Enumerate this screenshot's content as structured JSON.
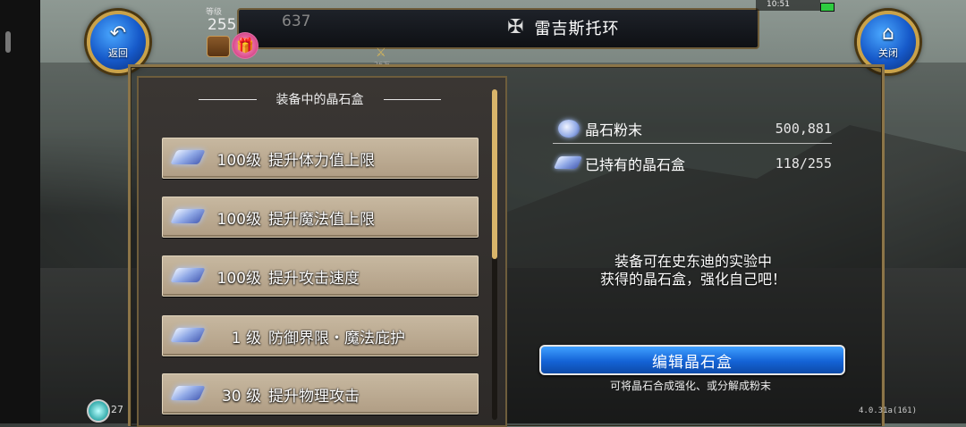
{
  "header": {
    "title": "雷吉斯托环",
    "title_icon": "guild-emblem-icon",
    "level_label": "等级",
    "level_value": "255",
    "hp_value": "637",
    "back_label": "返回",
    "close_label": "关闭",
    "status_time": "10:51",
    "sword_power_text": "26万"
  },
  "list": {
    "header": "装备中的晶石盒",
    "items": [
      {
        "level": "100级",
        "name": "提升体力值上限"
      },
      {
        "level": "100级",
        "name": "提升魔法值上限"
      },
      {
        "level": "100级",
        "name": "提升攻击速度"
      },
      {
        "level": "1 级",
        "name": "防御界限・魔法庇护"
      },
      {
        "level": "30 级",
        "name": "提升物理攻击"
      }
    ]
  },
  "info": {
    "powder_label": "晶石粉末",
    "powder_value": "500,881",
    "boxes_label": "已持有的晶石盒",
    "boxes_value": "118/255"
  },
  "description": {
    "line1": "装备可在史东迪的实验中",
    "line2": "获得的晶石盒，强化自己吧！"
  },
  "edit_button": {
    "label": "编辑晶石盒",
    "hint": "可将晶石合成强化、或分解成粉末"
  },
  "footer": {
    "left_value": "27",
    "version": "4.0.31a(161)"
  },
  "colors": {
    "accent_blue": "#1463d6",
    "gold_border": "#8c7548",
    "item_bg": "#c7b8a0"
  }
}
